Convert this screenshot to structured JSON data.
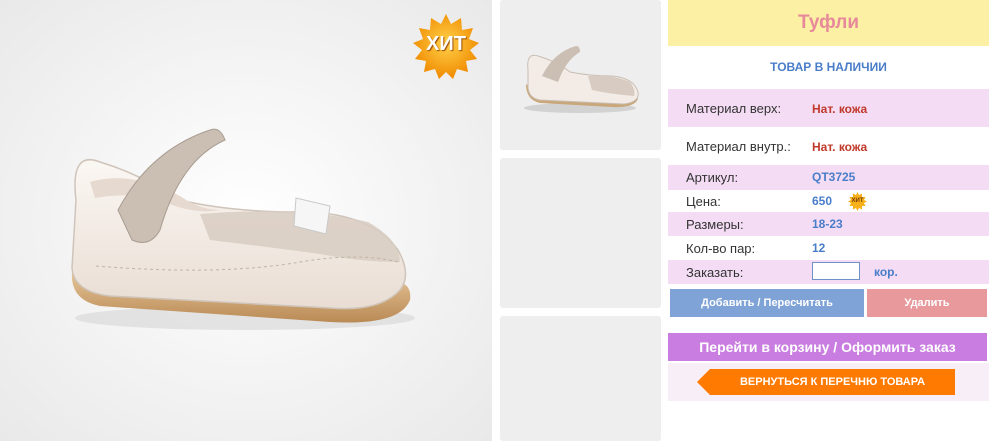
{
  "gallery": {
    "badge_text": "ХИТ",
    "main_image_subject": "white-leather-mary-jane-shoe",
    "thumbnails": [
      "shoe-side-view",
      "empty",
      "empty"
    ]
  },
  "product": {
    "title": "Туфли",
    "stock_status": "ТОВАР В НАЛИЧИИ",
    "specs": {
      "material_upper_label": "Материал верх:",
      "material_upper_value": "Нат. кожа",
      "material_inner_label": "Материал внутр.:",
      "material_inner_value": "Нат. кожа",
      "article_label": "Артикул:",
      "article_value": "QT3725",
      "price_label": "Цена:",
      "price_value": "650",
      "price_badge": "ХИТ",
      "sizes_label": "Размеры:",
      "sizes_value": "18-23",
      "pairs_label": "Кол-во пар:",
      "pairs_value": "12"
    },
    "order": {
      "label": "Заказать:",
      "quantity_value": "",
      "unit": "кор."
    }
  },
  "actions": {
    "add_label": "Добавить / Пересчитать",
    "delete_label": "Удалить",
    "cart_label": "Перейти в корзину / Оформить заказ",
    "back_label": "ВЕРНУТЬСЯ К ПЕРЕЧНЮ ТОВАРА"
  },
  "colors": {
    "title_bg": "#fbf0a3",
    "title_text": "#e8899b",
    "row_highlight": "#f4ddf4",
    "accent_blue": "#4a7dc9",
    "value_red": "#c0392b",
    "add_button": "#7fa3d6",
    "delete_button": "#e8999c",
    "cart_button": "#c97de0",
    "back_button": "#ff7a00"
  }
}
